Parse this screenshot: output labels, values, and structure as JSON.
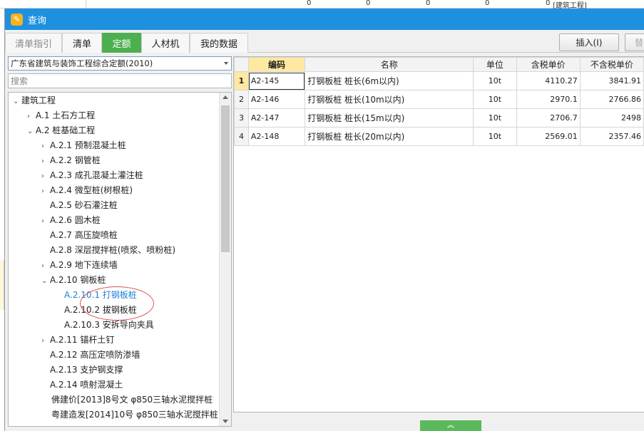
{
  "background": {
    "top_values": [
      "0",
      "0",
      "0",
      "0",
      "0"
    ],
    "top_tag": "[建筑工程]"
  },
  "dialog": {
    "title": "查询",
    "title_icon": "edit-icon",
    "accent": "#1e90e0",
    "tabs": [
      {
        "label": "清单指引",
        "state": "disabled"
      },
      {
        "label": "清单",
        "state": "normal"
      },
      {
        "label": "定额",
        "state": "active"
      },
      {
        "label": "人材机",
        "state": "normal"
      },
      {
        "label": "我的数据",
        "state": "normal"
      }
    ],
    "tab_active_color": "#4caf50",
    "insert_button": "插入(I)",
    "replace_button": "替"
  },
  "left": {
    "dropdown_value": "广东省建筑与装饰工程综合定额(2010)",
    "search_placeholder": "搜索",
    "tree": [
      {
        "label": "建筑工程",
        "toggle": "v",
        "level": 0
      },
      {
        "label": "A.1 土石方工程",
        "toggle": ">",
        "level": 1
      },
      {
        "label": "A.2 桩基础工程",
        "toggle": "v",
        "level": 1
      },
      {
        "label": "A.2.1 预制混凝土桩",
        "toggle": ">",
        "level": 2
      },
      {
        "label": "A.2.2 钢管桩",
        "toggle": ">",
        "level": 2
      },
      {
        "label": "A.2.3 成孔混凝土灌注桩",
        "toggle": ">",
        "level": 2
      },
      {
        "label": "A.2.4 微型桩(树根桩)",
        "toggle": ">",
        "level": 2
      },
      {
        "label": "A.2.5 砂石灌注桩",
        "toggle": "",
        "level": 2
      },
      {
        "label": "A.2.6 圆木桩",
        "toggle": ">",
        "level": 2
      },
      {
        "label": "A.2.7 高压旋喷桩",
        "toggle": "",
        "level": 2
      },
      {
        "label": "A.2.8 深层搅拌桩(喷浆、喷粉桩)",
        "toggle": "",
        "level": 2
      },
      {
        "label": "A.2.9 地下连续墙",
        "toggle": ">",
        "level": 2
      },
      {
        "label": "A.2.10 钢板桩",
        "toggle": "v",
        "level": 2
      },
      {
        "label": "A.2.10.1 打钢板桩",
        "toggle": "",
        "level": 3,
        "selected": true
      },
      {
        "label": "A.2.10.2 拔钢板桩",
        "toggle": "",
        "level": 3
      },
      {
        "label": "A.2.10.3 安拆导向夹具",
        "toggle": "",
        "level": 3
      },
      {
        "label": "A.2.11 锚杆土钉",
        "toggle": ">",
        "level": 2
      },
      {
        "label": "A.2.12 高压定喷防渗墙",
        "toggle": "",
        "level": 2
      },
      {
        "label": "A.2.13 支护钢支撑",
        "toggle": "",
        "level": 2
      },
      {
        "label": "A.2.14 喷射混凝土",
        "toggle": "",
        "level": 2
      },
      {
        "label": "佛建价[2013]8号文 φ850三轴水泥搅拌桩",
        "toggle": "",
        "level": 4
      },
      {
        "label": "粤建造发[2014]10号 φ850三轴水泥搅拌桩",
        "toggle": "",
        "level": 4
      }
    ]
  },
  "grid": {
    "headers": [
      "编码",
      "名称",
      "单位",
      "含税单价",
      "不含税单价"
    ],
    "rows": [
      {
        "idx": "1",
        "code": "A2-145",
        "name": "打钢板桩 桩长(6m以内)",
        "unit": "10t",
        "price_tax": "4110.27",
        "price_notax": "3841.91"
      },
      {
        "idx": "2",
        "code": "A2-146",
        "name": "打钢板桩 桩长(10m以内)",
        "unit": "10t",
        "price_tax": "2970.1",
        "price_notax": "2766.86"
      },
      {
        "idx": "3",
        "code": "A2-147",
        "name": "打钢板桩 桩长(15m以内)",
        "unit": "10t",
        "price_tax": "2706.7",
        "price_notax": "2498"
      },
      {
        "idx": "4",
        "code": "A2-148",
        "name": "打钢板桩 桩长(20m以内)",
        "unit": "10t",
        "price_tax": "2569.01",
        "price_notax": "2357.46"
      }
    ]
  },
  "bottom_handle": "︽"
}
